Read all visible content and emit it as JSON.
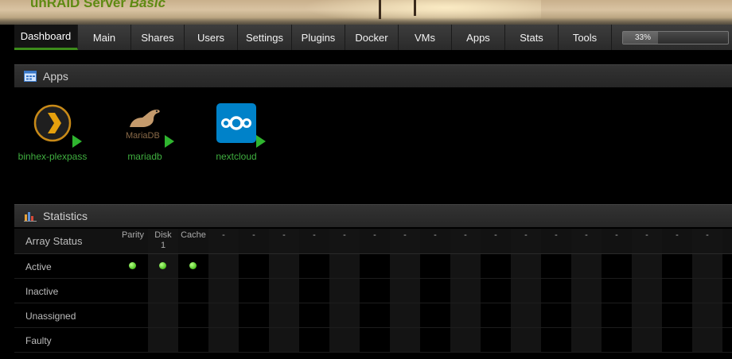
{
  "header": {
    "title_plain": "unRAID Server ",
    "title_italic": "Basic"
  },
  "nav": {
    "items": [
      {
        "label": "Dashboard",
        "active": true
      },
      {
        "label": "Main"
      },
      {
        "label": "Shares"
      },
      {
        "label": "Users"
      },
      {
        "label": "Settings"
      },
      {
        "label": "Plugins"
      },
      {
        "label": "Docker"
      },
      {
        "label": "VMs"
      },
      {
        "label": "Apps"
      },
      {
        "label": "Stats"
      },
      {
        "label": "Tools"
      }
    ],
    "progress_label": "33%",
    "progress_value": 0.33
  },
  "apps_section": {
    "title": "Apps",
    "icon": "apps-grid-icon",
    "apps": [
      {
        "label": "binhex-plexpass",
        "icon": "plex-icon"
      },
      {
        "label": "mariadb",
        "icon": "mariadb-icon",
        "logo_text": "MariaDB"
      },
      {
        "label": "nextcloud",
        "icon": "nextcloud-icon"
      }
    ]
  },
  "stats_section": {
    "title": "Statistics",
    "icon": "bar-chart-icon",
    "array_status_label": "Array Status",
    "columns": [
      "Parity",
      "Disk\n1",
      "Cache",
      "-",
      "-",
      "-",
      "-",
      "-",
      "-",
      "-",
      "-",
      "-",
      "-",
      "-",
      "-",
      "-",
      "-",
      "-",
      "-",
      "-"
    ],
    "rows": [
      {
        "label": "Active",
        "dots": [
          0,
          1,
          2
        ]
      },
      {
        "label": "Inactive",
        "dots": []
      },
      {
        "label": "Unassigned",
        "dots": []
      },
      {
        "label": "Faulty",
        "dots": []
      }
    ]
  },
  "colors": {
    "accent_green": "#3d8c1b",
    "status_green": "#4cc21f",
    "link_green": "#3fae3f"
  }
}
